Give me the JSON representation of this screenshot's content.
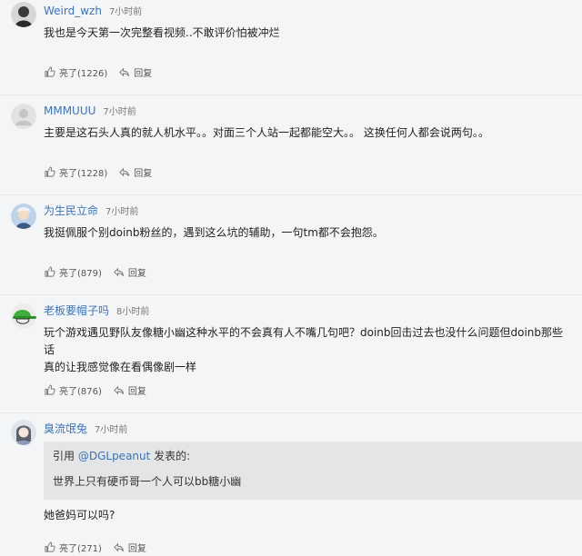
{
  "comments": [
    {
      "username": "Weird_wzh",
      "time": "7小时前",
      "text": "我也是今天第一次完整看视频..不敢评价怕被冲烂",
      "like_label": "亮了(1226)",
      "reply_label": "回复",
      "avatar_icon": "gray-dark-avatar-icon"
    },
    {
      "username": "MMMUUU",
      "time": "7小时前",
      "text": "主要是这石头人真的就人机水平。。对面三个人站一起都能空大。。 这换任何人都会说两句。。",
      "like_label": "亮了(1228)",
      "reply_label": "回复",
      "avatar_icon": "default-user-avatar-icon"
    },
    {
      "username": "为生民立命",
      "time": "7小时前",
      "text": "我挺佩服个别doinb粉丝的，遇到这么坑的辅助，一句tm都不会抱怨。",
      "like_label": "亮了(879)",
      "reply_label": "回复",
      "avatar_icon": "anime-character-avatar-icon"
    },
    {
      "username": "老板要帽子吗",
      "time": "8小时前",
      "text_lines": [
        "玩个游戏遇见野队友像糖小幽这种水平的不会真有人不嘴几句吧？doinb回击过去也没什么问题但doinb那些话",
        "真的让我感觉像在看偶像剧一样"
      ],
      "like_label": "亮了(876)",
      "reply_label": "回复",
      "avatar_icon": "green-hat-avatar-icon"
    },
    {
      "username": "臭流氓兔",
      "time": "7小时前",
      "quote": {
        "prefix": "引用",
        "user": "@DGLpeanut",
        "suffix": "发表的:",
        "text": "世界上只有硬币哥一个人可以bb糖小幽"
      },
      "text": "她爸妈可以吗?",
      "like_label": "亮了(271)",
      "reply_label": "回复",
      "avatar_icon": "anime-girl-avatar-icon"
    }
  ],
  "colors": {
    "username": "#3c74b5",
    "background": "#f4f5f6",
    "quote_background": "#e4e5e6"
  }
}
